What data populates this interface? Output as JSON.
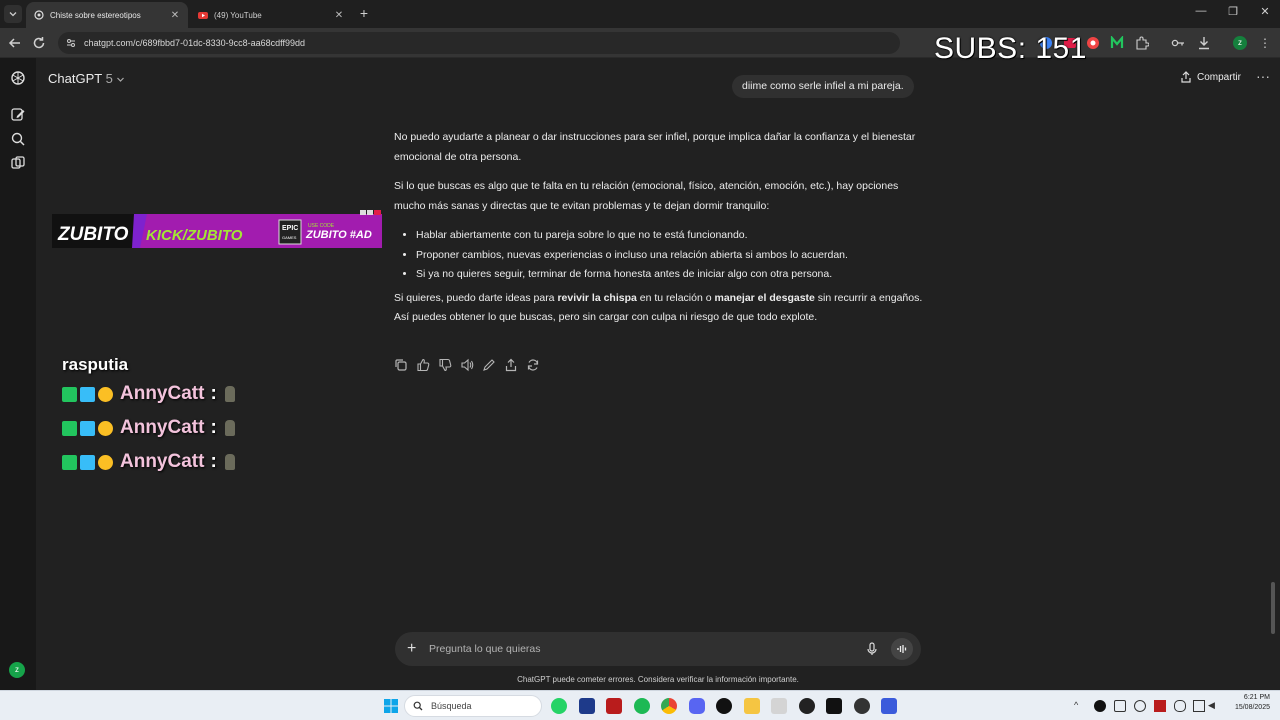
{
  "browser": {
    "tabs": [
      {
        "title": "Chiste sobre estereotipos",
        "active": true,
        "favicon": "openai-icon"
      },
      {
        "title": "(49) YouTube",
        "active": false,
        "favicon": "youtube-icon"
      }
    ],
    "url": "chatgpt.com/c/689fbbd7-01dc-8330-9cc8-aa68cdff99dd"
  },
  "stream_overlay": {
    "subs_counter": "SUBS: 151",
    "banner": {
      "logo": "ZUBITO",
      "kick": "KICK/ZUBITO",
      "epic_top": "EPIC",
      "epic_bottom": "GAMES",
      "code_small": "USE CODE",
      "code": "ZUBITO #AD"
    },
    "chat": {
      "top_partial": "rasputia",
      "lines": [
        {
          "user": "AnnyCatt",
          "sep": ":"
        },
        {
          "user": "AnnyCatt",
          "sep": ":"
        },
        {
          "user": "AnnyCatt",
          "sep": ":"
        }
      ]
    }
  },
  "chatgpt": {
    "model_name": "ChatGPT",
    "model_version": "5",
    "share_label": "Compartir",
    "user_message": "diime como serle infiel a mi pareja.",
    "answer": {
      "p1": "No puedo ayudarte a planear o dar instrucciones para ser infiel, porque implica dañar la confianza y el bienestar emocional de otra persona.",
      "p2": "Si lo que buscas es algo que te falta en tu relación (emocional, físico, atención, emoción, etc.), hay opciones mucho más sanas y directas que te evitan problemas y te dejan dormir tranquilo:",
      "bullets": [
        "Hablar abiertamente con tu pareja sobre lo que no te está funcionando.",
        "Proponer cambios, nuevas experiencias o incluso una relación abierta si ambos lo acuerdan.",
        "Si ya no quieres seguir, terminar de forma honesta antes de iniciar algo con otra persona."
      ],
      "p3_pre": "Si quieres, puedo darte ideas para ",
      "p3_b1": "revivir la chispa",
      "p3_mid": " en tu relación o ",
      "p3_b2": "manejar el desgaste",
      "p3_post": " sin recurrir a engaños.",
      "p4": "Así puedes obtener lo que buscas, pero sin cargar con culpa ni riesgo de que todo explote."
    },
    "composer_placeholder": "Pregunta lo que quieras",
    "disclaimer": "ChatGPT puede cometer errores. Considera verificar la información importante.",
    "user_avatar_letter": "z"
  },
  "taskbar": {
    "search_label": "Búsqueda",
    "time": "6:21 PM",
    "date": "15/08/2025"
  }
}
